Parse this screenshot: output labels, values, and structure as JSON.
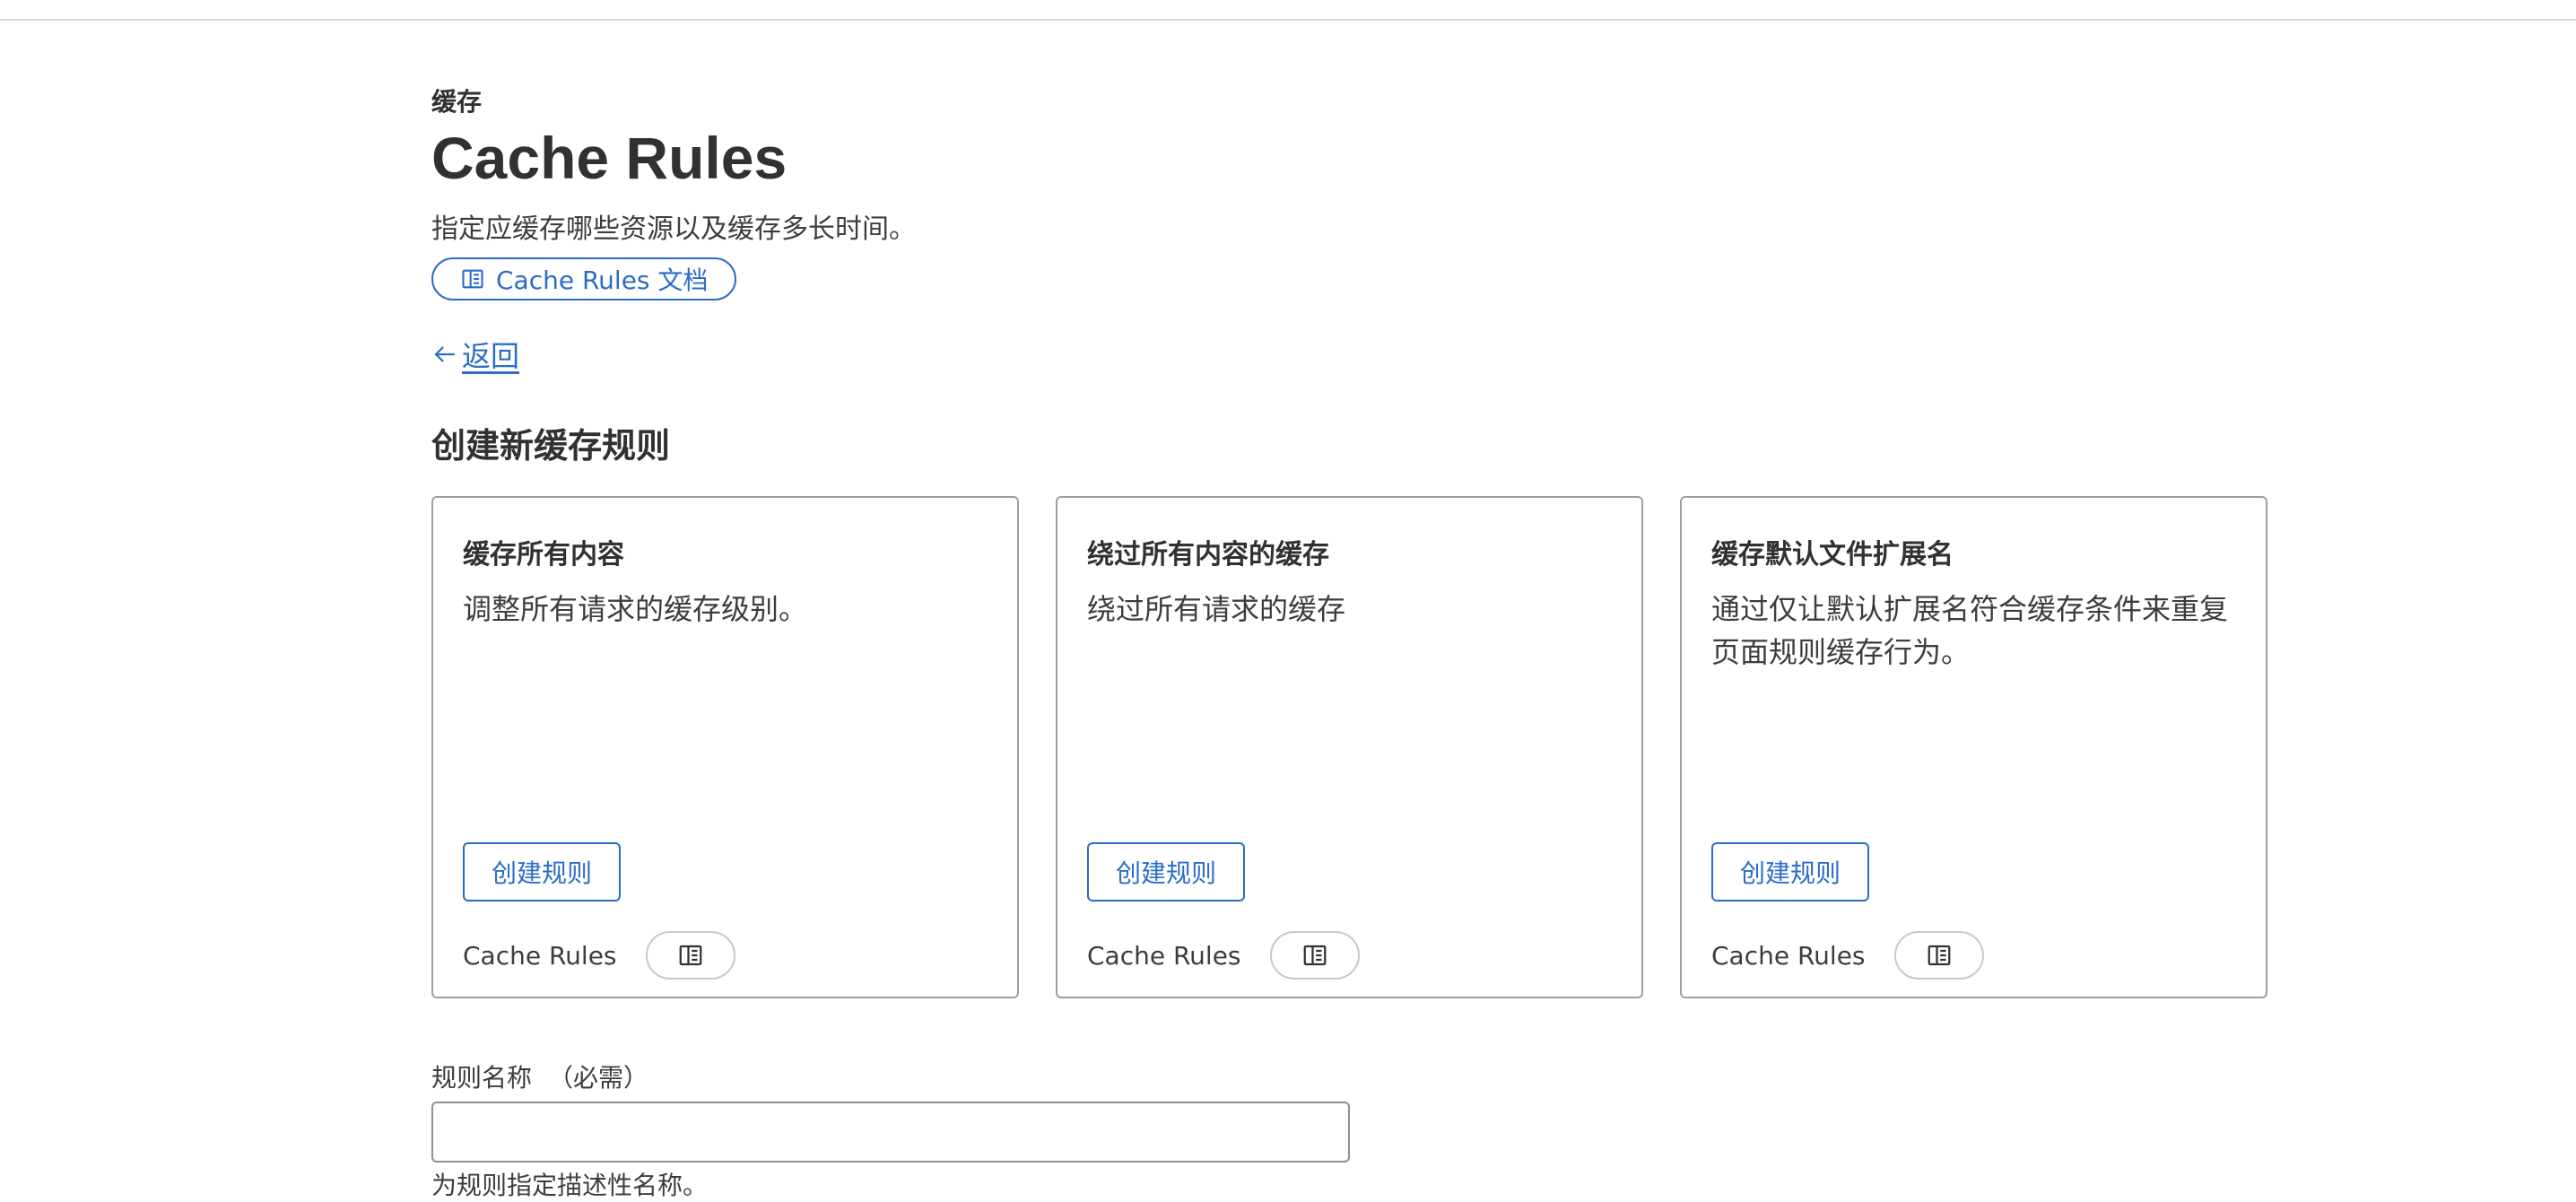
{
  "header": {
    "eyebrow": "缓存",
    "title": "Cache Rules",
    "subtitle": "指定应缓存哪些资源以及缓存多长时间。",
    "docs_link": "Cache Rules 文档",
    "docs_icon": "book-icon"
  },
  "back": {
    "icon": "arrow-left-icon",
    "label": "返回"
  },
  "section": {
    "title": "创建新缓存规则"
  },
  "cards": [
    {
      "title": "缓存所有内容",
      "description": "调整所有请求的缓存级别。",
      "button": "创建规则",
      "footer_label": "Cache Rules",
      "footer_icon": "book-icon"
    },
    {
      "title": "绕过所有内容的缓存",
      "description": "绕过所有请求的缓存",
      "button": "创建规则",
      "footer_label": "Cache Rules",
      "footer_icon": "book-icon"
    },
    {
      "title": "缓存默认文件扩展名",
      "description": "通过仅让默认扩展名符合缓存条件来重复页面规则缓存行为。",
      "button": "创建规则",
      "footer_label": "Cache Rules",
      "footer_icon": "book-icon"
    }
  ],
  "form": {
    "rule_name_label": "规则名称",
    "rule_name_required": "（必需）",
    "rule_name_value": "",
    "rule_name_help": "为规则指定描述性名称。"
  },
  "colors": {
    "accent": "#2c6cc9",
    "text": "#313131",
    "border": "#9e9e9e"
  }
}
